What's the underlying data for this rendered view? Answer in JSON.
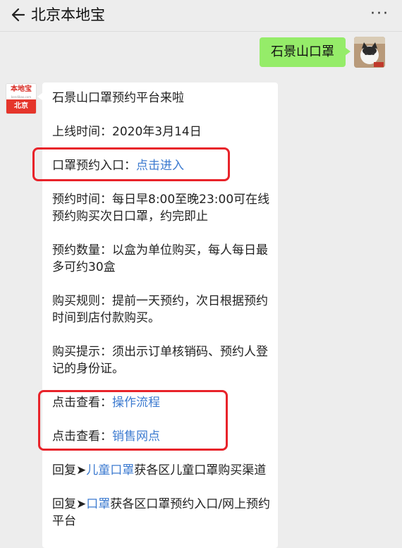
{
  "header": {
    "title": "北京本地宝",
    "back_icon": "arrow-left-icon",
    "more_icon": "more-dots-icon",
    "more_glyph": "···"
  },
  "user_message": {
    "text": "石景山口罩",
    "bubble_color": "#95ec69"
  },
  "bot": {
    "avatar_logo": "本地宝",
    "avatar_url": "bendibao.com",
    "avatar_city": "北京"
  },
  "bot_message": {
    "line1": "石景山口罩预约平台来啦",
    "online_time": "上线时间：2020年3月14日",
    "entry_label": "口罩预约入口：",
    "entry_link": "点击进入",
    "reserve_time": "预约时间：每日早8:00至晚23:00可在线预约购买次日口罩，约完即止",
    "reserve_qty": "预约数量：以盒为单位购买，每人每日最多可约30盒",
    "buy_rule": "购买规则：提前一天预约，次日根据预约时间到店付款购买。",
    "buy_tip": "购买提示：须出示订单核销码、预约人登记的身份证。",
    "view_label_1": "点击查看：",
    "view_link_1": "操作流程",
    "view_label_2": "点击查看：",
    "view_link_2": "销售网点",
    "reply_1_prefix": "回复➤",
    "reply_1_link": "儿童口罩",
    "reply_1_suffix": "获各区儿童口罩购买渠道",
    "reply_2_prefix": "回复➤",
    "reply_2_link": "口罩",
    "reply_2_suffix": "获各区口罩预约入口/网上预约平台"
  },
  "colors": {
    "link": "#3d7bd0",
    "highlight_box": "#e8232a",
    "background": "#ededed"
  }
}
